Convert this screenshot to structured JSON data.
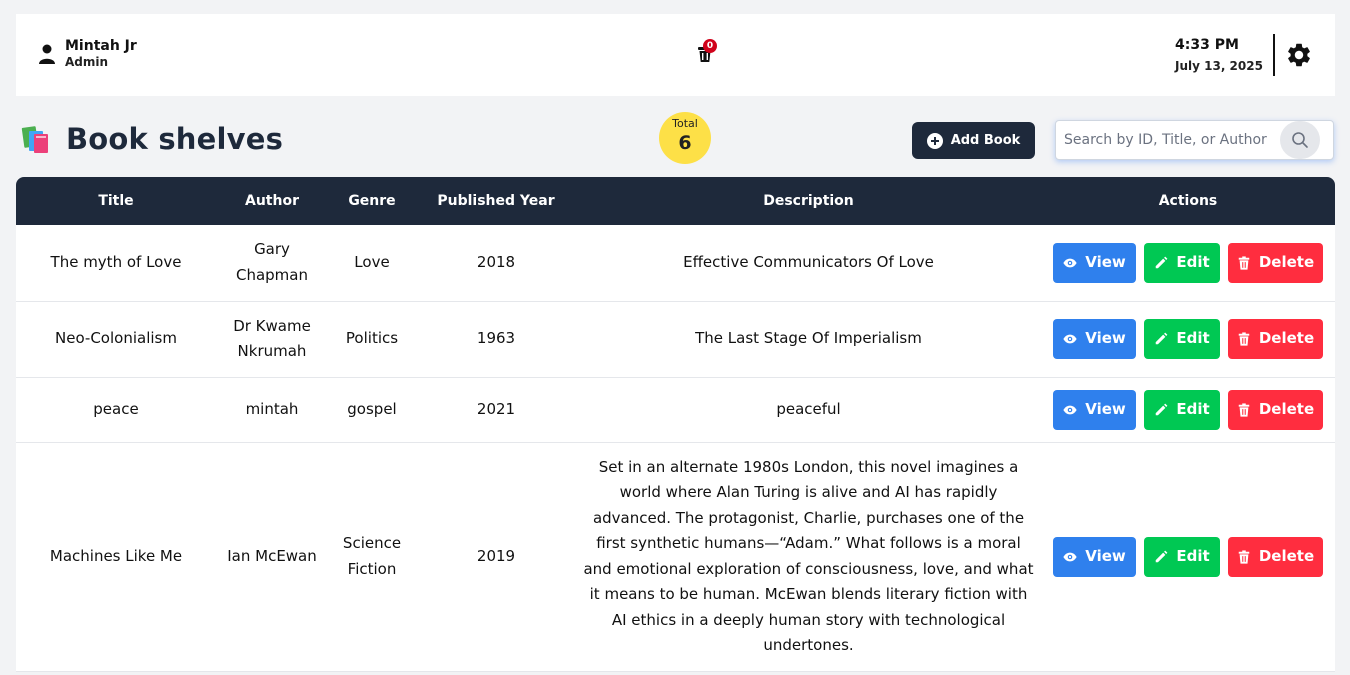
{
  "header": {
    "user_name": "Mintah Jr",
    "user_role": "Admin",
    "trash_count": "0",
    "time": "4:33 PM",
    "date": "July 13, 2025"
  },
  "page": {
    "title": "Book shelves",
    "total_label": "Total",
    "total_value": "6",
    "add_button_label": "Add Book",
    "search_placeholder": "Search by ID, Title, or Author"
  },
  "table": {
    "headers": [
      "Title",
      "Author",
      "Genre",
      "Published Year",
      "Description",
      "Actions"
    ],
    "rows": [
      {
        "title": "The myth of Love",
        "author": "Gary Chapman",
        "genre": "Love",
        "year": "2018",
        "description": "Effective Communicators Of Love"
      },
      {
        "title": "Neo-Colonialism",
        "author": "Dr Kwame Nkrumah",
        "genre": "Politics",
        "year": "1963",
        "description": "The Last Stage Of Imperialism"
      },
      {
        "title": "peace",
        "author": "mintah",
        "genre": "gospel",
        "year": "2021",
        "description": "peaceful"
      },
      {
        "title": "Machines Like Me",
        "author": "Ian McEwan",
        "genre": "Science Fiction",
        "year": "2019",
        "description": "Set in an alternate 1980s London, this novel imagines a world where Alan Turing is alive and AI has rapidly advanced. The protagonist, Charlie, purchases one of the first synthetic humans—“Adam.” What follows is a moral and emotional exploration of consciousness, love, and what it means to be human. McEwan blends literary fiction with AI ethics in a deeply human story with technological undertones."
      }
    ],
    "action_labels": {
      "view": "View",
      "edit": "Edit",
      "delete": "Delete"
    }
  },
  "colors": {
    "header_bg": "#1e293b",
    "view": "#2f80ed",
    "edit": "#00c853",
    "delete": "#ff2d3f",
    "total_badge": "#fde047",
    "trash_badge": "#d0021b"
  },
  "icons": [
    "user-icon",
    "trash-icon",
    "gear-icon",
    "books-icon",
    "plus-circle-icon",
    "search-icon",
    "eye-icon",
    "pencil-icon",
    "trash-can-icon"
  ]
}
